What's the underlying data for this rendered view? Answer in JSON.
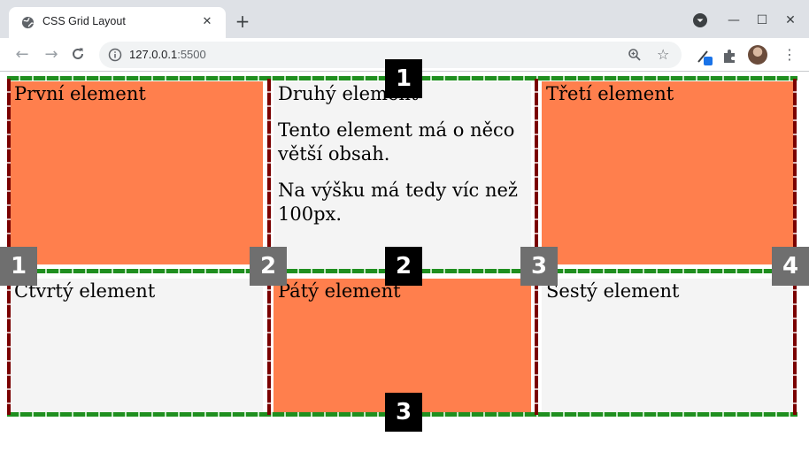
{
  "browser": {
    "tab_title": "CSS Grid Layout",
    "tab_close": "✕",
    "new_tab": "+",
    "url_host": "127.0.0.1",
    "url_port": ":5500",
    "window_controls": {
      "minimize": "—",
      "maximize": "☐",
      "close": "✕"
    }
  },
  "grid": {
    "cells": [
      {
        "name": "cell-1",
        "color": "orange",
        "paragraphs": [
          "První element"
        ]
      },
      {
        "name": "cell-2",
        "color": "gray",
        "paragraphs": [
          "Druhý element",
          "Tento element má o něco větší obsah.",
          "Na výšku má tedy víc než 100px."
        ]
      },
      {
        "name": "cell-3",
        "color": "orange",
        "paragraphs": [
          "Třetí element"
        ]
      },
      {
        "name": "cell-4",
        "color": "gray",
        "paragraphs": [
          "Čtvrtý element"
        ]
      },
      {
        "name": "cell-5",
        "color": "orange",
        "paragraphs": [
          "Pátý element"
        ]
      },
      {
        "name": "cell-6",
        "color": "gray",
        "paragraphs": [
          "Šestý element"
        ]
      }
    ],
    "row_line_labels": [
      "1",
      "2",
      "3"
    ],
    "column_line_labels": [
      "1",
      "2",
      "3",
      "4"
    ]
  },
  "colors": {
    "orange": "#ff7f4d",
    "gray": "#f4f4f4",
    "row_line": "#1f8f1f",
    "column_line": "#7a0000"
  }
}
